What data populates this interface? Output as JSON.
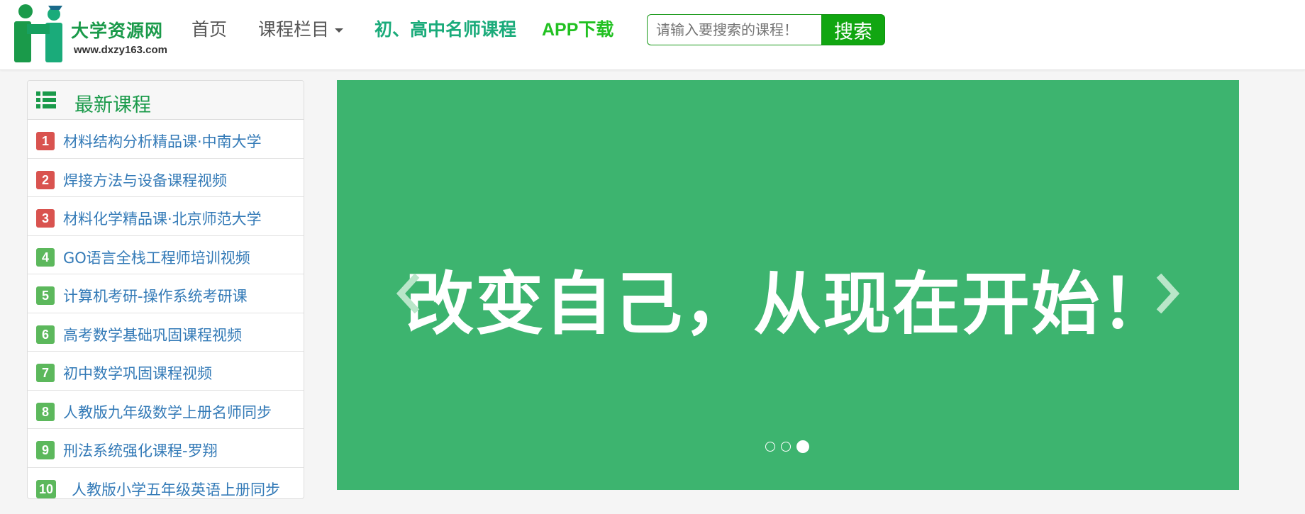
{
  "header": {
    "logo": {
      "title": "大学资源网",
      "url": "www.dxzy163.com"
    },
    "nav": {
      "home": "首页",
      "courses": "课程栏目",
      "teachers": "初、高中名师课程",
      "app": "APP下载"
    },
    "search": {
      "placeholder": "请输入要搜索的课程！",
      "button": "搜索"
    }
  },
  "sidebar": {
    "title": "最新课程",
    "items": [
      {
        "num": "1",
        "label": "材料结构分析精品课·中南大学",
        "color": "red"
      },
      {
        "num": "2",
        "label": "焊接方法与设备课程视频",
        "color": "red"
      },
      {
        "num": "3",
        "label": "材料化学精品课·北京师范大学",
        "color": "red"
      },
      {
        "num": "4",
        "label": "GO语言全栈工程师培训视频",
        "color": "green"
      },
      {
        "num": "5",
        "label": "计算机考研-操作系统考研课",
        "color": "green"
      },
      {
        "num": "6",
        "label": "高考数学基础巩固课程视频",
        "color": "green"
      },
      {
        "num": "7",
        "label": "初中数学巩固课程视频",
        "color": "green"
      },
      {
        "num": "8",
        "label": "人教版九年级数学上册名师同步",
        "color": "green"
      },
      {
        "num": "9",
        "label": "刑法系统强化课程-罗翔",
        "color": "green"
      },
      {
        "num": "10",
        "label": "人教版小学五年级英语上册同步",
        "color": "green"
      }
    ]
  },
  "carousel": {
    "slide_text": "改变自己，从现在开始！",
    "background": "#3db46f",
    "active_index": 3,
    "total": 3
  },
  "colors": {
    "brand_green": "#1a9a4a",
    "teal_link": "#1aab7a",
    "app_green": "#22c122",
    "search_button": "#11a611",
    "link_blue": "#337ab7",
    "badge_red": "#d9534f",
    "badge_green": "#5cb85c"
  }
}
